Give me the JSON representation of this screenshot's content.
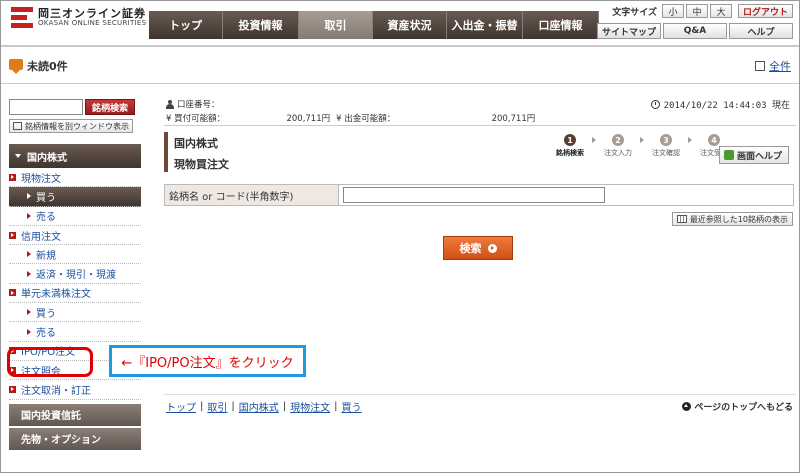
{
  "header": {
    "logo_jp": "岡三オンライン証券",
    "logo_en": "OKASAN ONLINE SECURITIES",
    "nav": [
      "トップ",
      "投資情報",
      "取引",
      "資産状況",
      "入出金・振替",
      "口座情報"
    ],
    "nav_active": "取引",
    "font_size_label": "文字サイズ",
    "font_sizes": [
      "小",
      "中",
      "大"
    ],
    "logout": "ログアウト",
    "util_links": [
      "サイトマップ",
      "Q&A",
      "ヘルプ"
    ]
  },
  "notice": {
    "unread": "未読0件",
    "all_link": "全件"
  },
  "sidebar": {
    "search_button": "銘柄検索",
    "window_button": "銘柄情報を別ウィンドウ表示",
    "section_domestic": "国内株式",
    "items": [
      {
        "label": "現物注文",
        "level": 1
      },
      {
        "label": "買う",
        "level": 2,
        "active": true
      },
      {
        "label": "売る",
        "level": 2
      },
      {
        "label": "信用注文",
        "level": 1
      },
      {
        "label": "新規",
        "level": 2
      },
      {
        "label": "返済・現引・現渡",
        "level": 2
      },
      {
        "label": "単元未満株注文",
        "level": 1
      },
      {
        "label": "買う",
        "level": 2
      },
      {
        "label": "売る",
        "level": 2
      },
      {
        "label": "IPO/PO注文",
        "level": 1
      },
      {
        "label": "注文照会",
        "level": 1
      },
      {
        "label": "注文取消・訂正",
        "level": 1
      }
    ],
    "section_investment_trust": "国内投資信託",
    "section_futures": "先物・オプション"
  },
  "main": {
    "account_number_label": "口座番号：",
    "buying_power_label": "¥ 買付可能額：",
    "buying_power_value": "200,711円",
    "withdrawable_label": "¥ 出金可能額：",
    "withdrawable_value": "200,711円",
    "datetime": "2014/10/22 14:44:03 現在",
    "title_line1": "国内株式",
    "title_line2": "現物買注文",
    "steps": [
      {
        "num": "1",
        "label": "銘柄検索",
        "active": true
      },
      {
        "num": "2",
        "label": "注文入力",
        "active": false
      },
      {
        "num": "3",
        "label": "注文確認",
        "active": false
      },
      {
        "num": "4",
        "label": "注文受付",
        "active": false
      }
    ],
    "help_button": "画面ヘルプ",
    "field_label": "銘柄名 or コード(半角数字)",
    "field_value": "",
    "recent_button": "最近参照した10銘柄の表示",
    "search_button": "検索",
    "breadcrumb": [
      "トップ",
      "取引",
      "国内株式",
      "現物注文",
      "買う"
    ],
    "page_top": "ページのトップへもどる"
  },
  "annotation": {
    "callout_text": "←『IPO/PO注文』をクリック"
  }
}
